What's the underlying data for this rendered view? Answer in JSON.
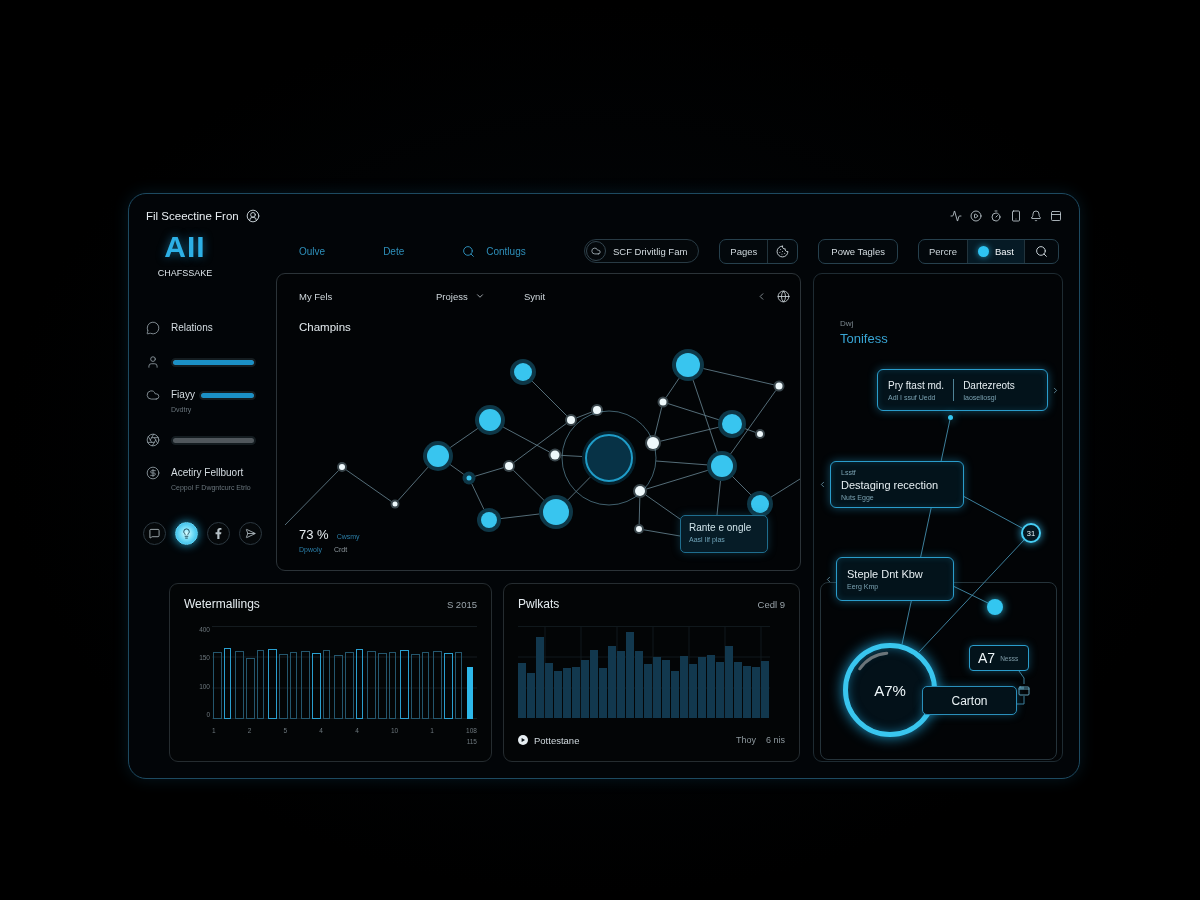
{
  "window": {
    "title": "Fil Sceectine Fron"
  },
  "logo": {
    "mark": "AII",
    "caption": "CHAFSSAKE"
  },
  "nav": [
    {
      "label": "Oulve",
      "kind": "link"
    },
    {
      "label": "Dete",
      "kind": "link"
    },
    {
      "label": "Contlugs",
      "kind": "search"
    }
  ],
  "toolbar": {
    "pill": "SCF Drivitlig Fam",
    "pages": "Pages",
    "tags": "Powe Tagles",
    "segments": [
      {
        "label": "Percre",
        "selected": false
      },
      {
        "label": "Bast",
        "selected": true
      }
    ]
  },
  "sidebar": {
    "items": [
      {
        "kind": "entry",
        "label": "Relations"
      },
      {
        "kind": "bar",
        "level": 1
      },
      {
        "kind": "bar",
        "label": "Fiayy",
        "sub": "Dvdtry",
        "level": 1
      },
      {
        "kind": "bar",
        "level": 0
      },
      {
        "kind": "entry",
        "label": "Acetiry Fellbuort",
        "sub": "Ceppol F Dwgntcurc Etrlo"
      }
    ],
    "shortcuts": [
      {
        "selected": false
      },
      {
        "selected": true
      },
      {
        "selected": false
      },
      {
        "selected": false
      }
    ]
  },
  "network": {
    "header": [
      {
        "label": "My Fels",
        "kind": "text"
      },
      {
        "label": "Projess",
        "kind": "dropdown"
      },
      {
        "label": "Synit",
        "kind": "text"
      }
    ],
    "title": "Champins",
    "stat": {
      "value": "73 %",
      "caption": "Cwsmy",
      "link": "Dpwoly",
      "note": "Crdt"
    },
    "callout": {
      "title": "Rante e ongle",
      "sub": "Aasl Ilf plas"
    }
  },
  "insights": {
    "eyebrow": "Dwj",
    "title": "Tonifess",
    "cards": [
      {
        "kind": "split",
        "columns": [
          {
            "title": "Pry ftast md.",
            "sub": "Adl I ssuf Uedd"
          },
          {
            "title": "Dartezreots",
            "sub": "Iaoseliosgi"
          }
        ]
      },
      {
        "kind": "stack",
        "eyebrow": "Lsstf",
        "title": "Destaging recection",
        "sub": "Nuts Egge"
      },
      {
        "kind": "stack",
        "title": "Steple Dnt Kbw",
        "sub": "Eerg Kmp"
      }
    ],
    "node": "31",
    "gauge": "A7%",
    "badge": {
      "value": "A7",
      "note": "Nesss"
    },
    "action": "Carton"
  },
  "charts": [
    {
      "kind": "outline",
      "title": "Wetermallings",
      "meta": "S 2015",
      "y_labels": [
        "400",
        "150",
        "100",
        "0"
      ],
      "x_labels": [
        "1",
        "2",
        "5",
        "4",
        "4",
        "10",
        "1",
        "108"
      ],
      "x_note": "115"
    },
    {
      "kind": "filled",
      "title": "Pwlkats",
      "meta": "Cedl 9",
      "legend": "Pottestane",
      "footer": [
        "Thoy",
        "6 nis"
      ]
    }
  ]
}
